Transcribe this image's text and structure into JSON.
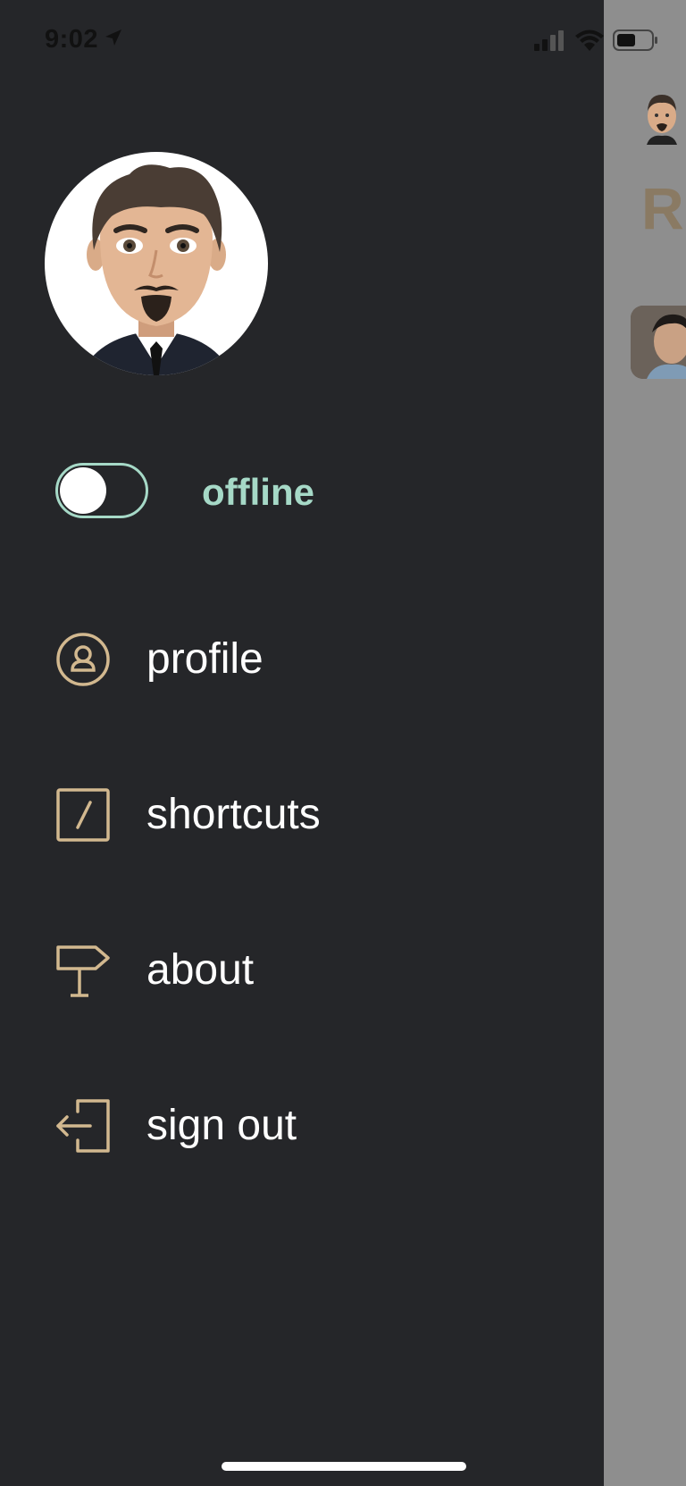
{
  "status_bar": {
    "time": "9:02",
    "icons": [
      "location-arrow-icon",
      "signal-icon",
      "wifi-icon",
      "battery-icon"
    ]
  },
  "drawer": {
    "avatar": "memoji-avatar",
    "presence": {
      "label": "offline",
      "online": false,
      "accent_color": "#a6d9c7"
    },
    "menu": [
      {
        "id": "profile",
        "label": "profile",
        "icon": "user-circle-icon"
      },
      {
        "id": "shortcuts",
        "label": "shortcuts",
        "icon": "slash-square-icon"
      },
      {
        "id": "about",
        "label": "about",
        "icon": "signpost-icon"
      },
      {
        "id": "sign-out",
        "label": "sign out",
        "icon": "sign-out-icon"
      }
    ],
    "icon_color": "#d2b88f",
    "background_color": "#252629"
  },
  "main_behind": {
    "title_fragment": "Re",
    "title_color": "#8a7a63"
  }
}
